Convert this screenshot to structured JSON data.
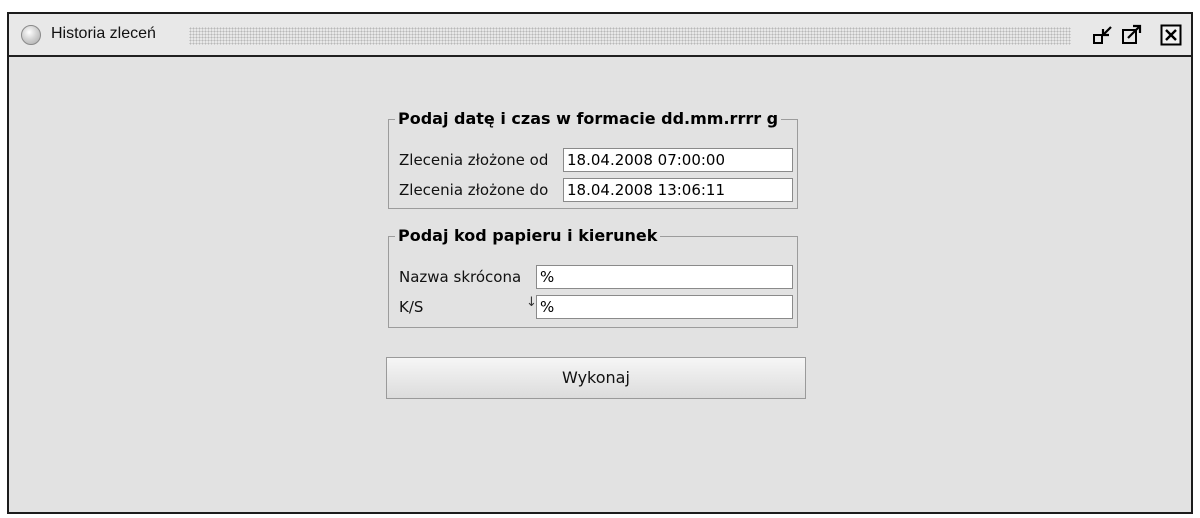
{
  "window": {
    "title": "Historia zleceń",
    "controls": [
      "minimize-icon",
      "maximize-icon",
      "close-icon"
    ]
  },
  "group_datetime": {
    "title": "Podaj datę i czas w formacie dd.mm.rrrr g",
    "from_label": "Zlecenia złożone od",
    "from_value": "18.04.2008 07:00:00",
    "to_label": "Zlecenia złożone do",
    "to_value": "18.04.2008 13:06:11"
  },
  "group_security": {
    "title": "Podaj kod papieru i kierunek",
    "name_label": "Nazwa skrócona",
    "name_value": "%",
    "side_label": "K/S",
    "side_marker": "↓",
    "side_value": "%"
  },
  "actions": {
    "execute_label": "Wykonaj"
  }
}
